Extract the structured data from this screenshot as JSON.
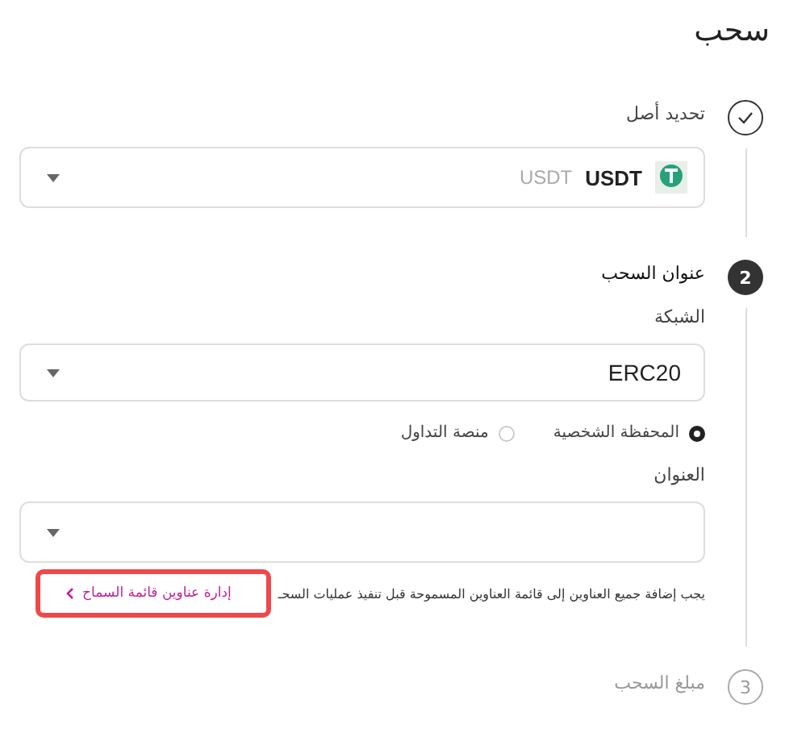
{
  "title": "سحب",
  "steps": [
    {
      "completed": true,
      "active": false,
      "label": "تحديد أصل"
    },
    {
      "completed": false,
      "active": true,
      "number": "2",
      "label": "عنوان السحب"
    },
    {
      "completed": false,
      "active": false,
      "number": "3",
      "label": "مبلغ السحب"
    }
  ],
  "asset_field": {
    "symbol": "USDT",
    "name": "USDT"
  },
  "network": {
    "label": "الشبكة",
    "value": "ERC20"
  },
  "address_type": [
    {
      "label": "المحفظة الشخصية",
      "selected": true
    },
    {
      "label": "منصة التداول",
      "selected": false
    }
  ],
  "address": {
    "label": "العنوان"
  },
  "notice": {
    "text": "يجب إضافة جميع العناوين إلى قائمة العناوين المسموحة قبل تنفيذ عمليات السحـ",
    "link": "إدارة عناوين قائمة السماح",
    "highlighted": true
  }
}
